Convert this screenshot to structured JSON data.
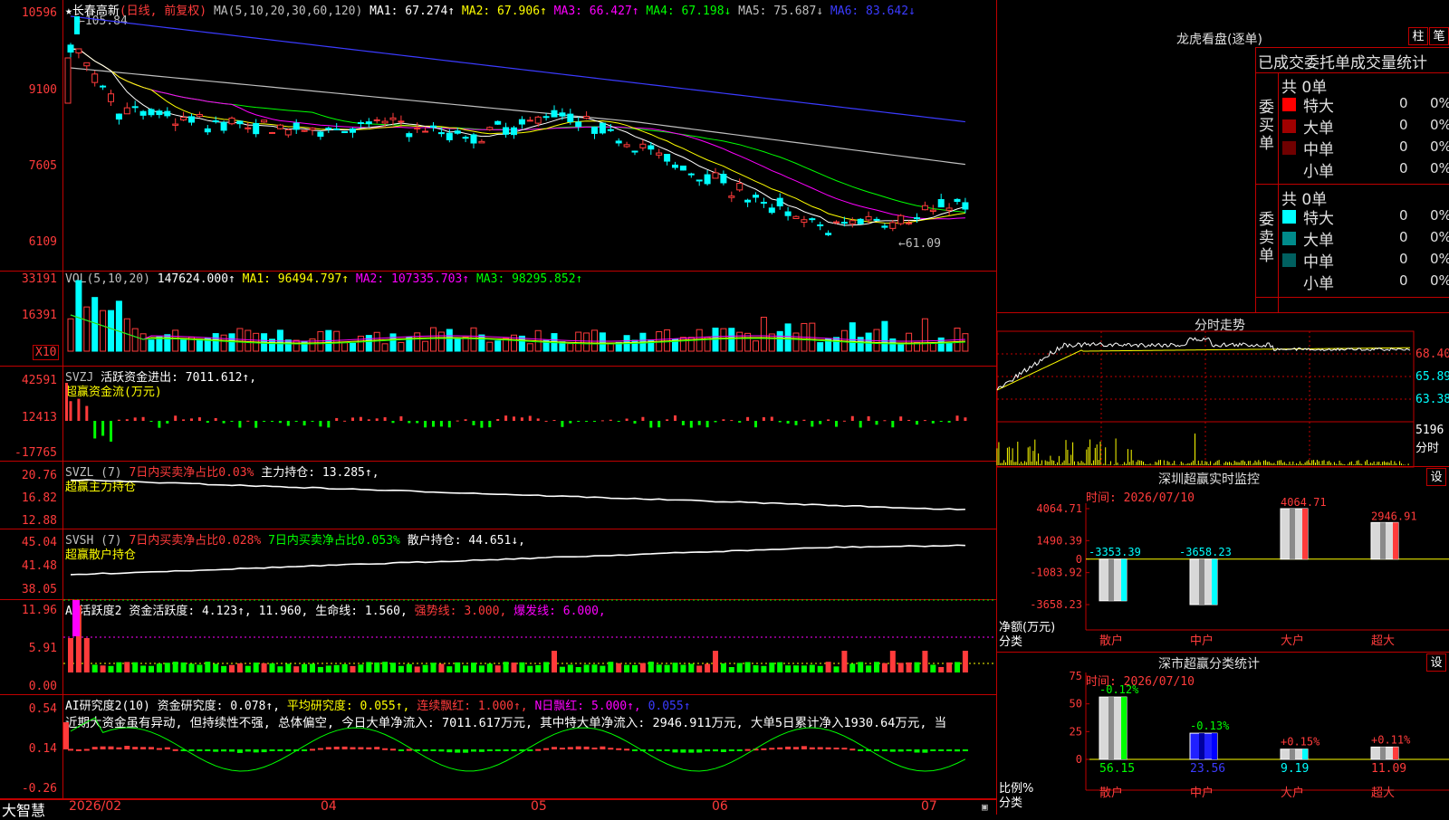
{
  "app": {
    "name": "大智慧"
  },
  "main": {
    "header": {
      "stock": "★长春高新",
      "mode": "(日线, 前复权)",
      "ma_label": "MA(5,10,20,30,60,120)",
      "ma1": "MA1: 67.274↑",
      "ma2": "MA2: 67.906↑",
      "ma3": "MA3: 66.427↑",
      "ma4": "MA4: 67.198↓",
      "ma5": "MA5: 75.687↓",
      "ma6": "MA6: 83.642↓"
    },
    "yticks": [
      "10596",
      "9100",
      "7605",
      "6109"
    ],
    "high_label": "←105.84",
    "low_label": "←61.09",
    "colors": {
      "ma1": "#ffffff",
      "ma2": "#ffff00",
      "ma3": "#ff00ff",
      "ma4": "#00ff00",
      "ma5": "#bfbfbf",
      "ma6": "#3b3bff"
    }
  },
  "vol": {
    "label": "VOL(5,10,20)",
    "value": "147624.000↑",
    "ma1": "MA1: 96494.797↑",
    "ma2": "MA2: 107335.703↑",
    "ma3": "MA3: 98295.852↑",
    "yticks": [
      "33191",
      "16391"
    ],
    "unit": "X10"
  },
  "svzj": {
    "label": "SVZJ",
    "text": "活跃资金进出: 7011.612↑,",
    "sub": "超赢资金流(万元)",
    "yticks": [
      "42591",
      "12413",
      "-17765"
    ]
  },
  "svzl": {
    "label": "SVZL (7)",
    "text1": "7日内买卖净占比0.03%",
    "text2": "主力持仓: 13.285↑,",
    "sub": "超赢主力持仓",
    "yticks": [
      "20.76",
      "16.82",
      "12.88"
    ]
  },
  "svsh": {
    "label": "SVSH (7)",
    "text1": "7日内买卖净占比0.028%",
    "text2": "7日内买卖净占比0.053%",
    "text3": "散户持仓: 44.651↓,",
    "sub": "超赢散户持仓",
    "yticks": [
      "45.04",
      "41.48",
      "38.05"
    ]
  },
  "ai1": {
    "label": "AI活跃度2",
    "text1": "资金活跃度: 4.123↑,",
    "text2": "11.960,",
    "text3": "生命线: 1.560,",
    "text4": "强势线: 3.000,",
    "text5": "爆发线: 6.000,",
    "yticks": [
      "11.96",
      "5.91",
      "0.00"
    ]
  },
  "ai2": {
    "label": "AI研究度2(10)",
    "text1": "资金研究度: 0.078↑,",
    "text2": "平均研究度: 0.055↑,",
    "text3": "连续飘红: 1.000↑,",
    "text4": "N日飘红: 5.000↑,",
    "text5": "0.055↑",
    "note": "近期大资金虽有异动, 但持续性不强, 总体偏空, 今日大单净流入: 7011.617万元, 其中特大单净流入: 2946.911万元, 大单5日累计净入1930.64万元, 当",
    "yticks": [
      "0.54",
      "0.14",
      "-0.26"
    ]
  },
  "xaxis": {
    "labels": [
      "2026/02",
      "04",
      "05",
      "06",
      "07"
    ]
  },
  "right": {
    "lhb": {
      "title": "龙虎看盘(逐单)",
      "btn1": "柱",
      "btn2": "笔",
      "heading": "已成交委托单成交量统计",
      "buy": {
        "side": "委买单",
        "total": "共 0单",
        "rows": [
          {
            "label": "特大",
            "count": "0",
            "pct": "0%",
            "color": "#ff0000"
          },
          {
            "label": "大单",
            "count": "0",
            "pct": "0%",
            "color": "#a00000"
          },
          {
            "label": "中单",
            "count": "0",
            "pct": "0%",
            "color": "#700000"
          },
          {
            "label": "小单",
            "count": "0",
            "pct": "0%",
            "color": "#000000"
          }
        ]
      },
      "sell": {
        "side": "委卖单",
        "total": "共 0单",
        "rows": [
          {
            "label": "特大",
            "count": "0",
            "pct": "0%",
            "color": "#00ffff"
          },
          {
            "label": "大单",
            "count": "0",
            "pct": "0%",
            "color": "#008b8b"
          },
          {
            "label": "中单",
            "count": "0",
            "pct": "0%",
            "color": "#006060"
          },
          {
            "label": "小单",
            "count": "0",
            "pct": "0%",
            "color": "#000000"
          }
        ]
      }
    },
    "intraday": {
      "title": "分时走势",
      "yticks": [
        "68.40",
        "65.89",
        "63.38"
      ],
      "vol_tick": "5196",
      "vol_unit": "分时"
    },
    "monitor": {
      "title": "深圳超赢实时监控",
      "btn": "设",
      "time": "时间: 2026/07/10",
      "yticks": [
        "4064.71",
        "1490.39",
        "0",
        "-1083.92",
        "-3658.23"
      ],
      "ylabel1": "净额(万元)",
      "ylabel2": "分类",
      "chart_data": {
        "type": "bar",
        "categories": [
          "散户",
          "中户",
          "大户",
          "超大"
        ],
        "values": [
          -3353.39,
          -3658.23,
          4064.71,
          2946.91
        ],
        "value_labels": [
          "-3353.39",
          "-3658.23",
          "4064.71",
          "2946.91"
        ],
        "ylim": [
          -3658.23,
          4064.71
        ]
      }
    },
    "classify": {
      "title": "深市超赢分类统计",
      "btn": "设",
      "time": "时间: 2026/07/10",
      "yticks": [
        "75",
        "50",
        "25",
        "0"
      ],
      "ylabel1": "比例%",
      "ylabel2": "分类",
      "chart_data": {
        "type": "bar",
        "categories": [
          "散户",
          "中户",
          "大户",
          "超大"
        ],
        "values": [
          56.15,
          23.56,
          9.19,
          11.09
        ],
        "change_labels": [
          "-0.12%",
          "-0.13%",
          "+0.15%",
          "+0.11%"
        ],
        "value_labels": [
          "56.15",
          "23.56",
          "9.19",
          "11.09"
        ],
        "ylim": [
          0,
          75
        ]
      }
    }
  }
}
